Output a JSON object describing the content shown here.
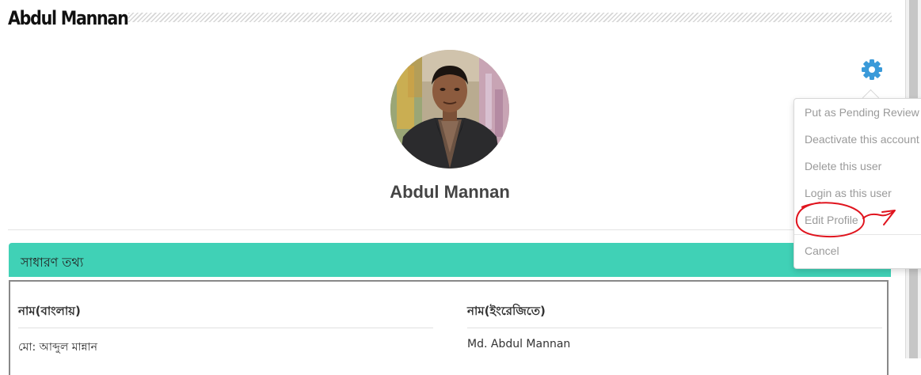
{
  "page": {
    "title": "Abdul Mannan"
  },
  "profile": {
    "name": "Abdul Mannan"
  },
  "section": {
    "title": "সাধারণ তথ্য",
    "fields": [
      {
        "label": "নাম(বাংলায়)",
        "value": "মো: আব্দুল মান্নান"
      },
      {
        "label": "নাম(ইংরেজিতে)",
        "value": "Md. Abdul Mannan"
      }
    ]
  },
  "actions_menu": {
    "items": [
      "Put as Pending Review",
      "Deactivate this account",
      "Delete this user",
      "Login as this user",
      "Edit Profile",
      "Cancel"
    ]
  },
  "colors": {
    "section_header": "#40d1b6",
    "gear_icon": "#3a9ad9",
    "annotation": "#e0141e",
    "menu_text": "#9a9a9a"
  },
  "icons": {
    "settings": "gear-icon",
    "avatar": "user-photo"
  }
}
